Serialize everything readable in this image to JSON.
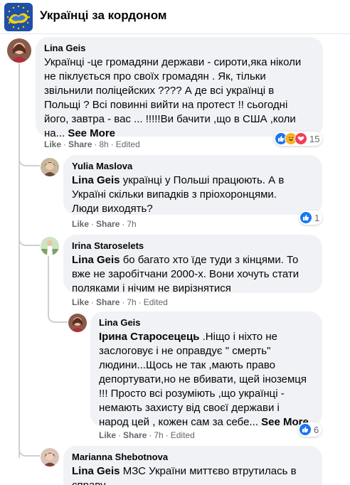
{
  "header": {
    "title": "Українці за кордоном",
    "logo_icon": "ukraine-eu-flag-icon"
  },
  "comments": [
    {
      "author": "Lina Geis",
      "text": "Українці -це громадяни держави - сироти,яка ніколи не піклується про своїх громадян . Як, тільки звільнили поліцейских ???? А де всі українці в Польщі ? Всі повинні вийти на протест !! сьогодні його, завтра - вас ... !!!!!Ви бачити ,що в США ,коли на...",
      "lines": [
        "Українці -це громадяни держави - сироти,яка ніколи",
        "не піклується про своїх громадян . Як, тільки",
        "звільнили поліцейских ???? А де всі українці в",
        "Польщі ? Всі повинні вийти на протест !! сьогодні",
        "його, завтра - вас ... !!!!!Ви бачити ,що в США ,коли",
        "на..."
      ],
      "see_more": "See More",
      "like": "Like",
      "share": "Share",
      "time": "8h",
      "edited": "Edited",
      "reaction_count": "15"
    },
    {
      "author": "Yulia Maslova",
      "mention": "Lina Geis",
      "text": "українці у Польші працюють. А в Україні скільки випадків з пріохоронцями. Люди виходять?",
      "lines": [
        "українці у Польші працюють. А в",
        "Україні скільки випадків з пріохоронцями.",
        "Люди виходять?"
      ],
      "like": "Like",
      "share": "Share",
      "time": "7h",
      "reaction_count": "1"
    },
    {
      "author": "Irina Staroselets",
      "mention": "Lina Geis",
      "text": "бо багато хто їде туди з кінцями. То вже не заробітчани 2000-х. Вони хочуть стати поляками і нічим не вирізнятися",
      "lines": [
        "бо багато хто їде туди з кінцями. То",
        "вже не заробітчани 2000-х. Вони хочуть стати",
        "поляками і нічим не вирізнятися"
      ],
      "like": "Like",
      "share": "Share",
      "time": "7h",
      "edited": "Edited"
    },
    {
      "author": "Lina Geis",
      "mention": "Ірина Старосецець",
      "text": ".Ніщо і ніхто не заслоговує і не оправдує \" смерть\" людини...Щось не так ,мають право депортувати,но не вбивати, щей іноземця !!! Просто всі розуміють ,що українці - немають захисту від своєї держави і народ цей , кожен сам за себе...",
      "lines": [
        ".Ніщо і ніхто не",
        "заслоговує і не оправдує \" смерть\"",
        "людини...Щось не так ,мають право",
        "депортувати,но не вбивати, щей іноземця",
        "!!! Просто всі розуміють ,що українці -",
        "немають захисту від своєї держави і",
        "народ цей , кожен сам за себе..."
      ],
      "see_more": "See More",
      "like": "Like",
      "share": "Share",
      "time": "7h",
      "edited": "Edited",
      "reaction_count": "6"
    },
    {
      "author": "Marianna Shebotnova",
      "mention": "Lina Geis",
      "text": "МЗС України миттєво втрутилась в справу.",
      "lines": [
        "МЗС України миттєво втрутилась в",
        "справу."
      ]
    }
  ],
  "colors": {
    "like_blue": "#1877f2",
    "love_red": "#f33e58",
    "haha_yellow": "#f7b125",
    "bubble_bg": "#f0f2f5",
    "meta_gray": "#65676b"
  }
}
